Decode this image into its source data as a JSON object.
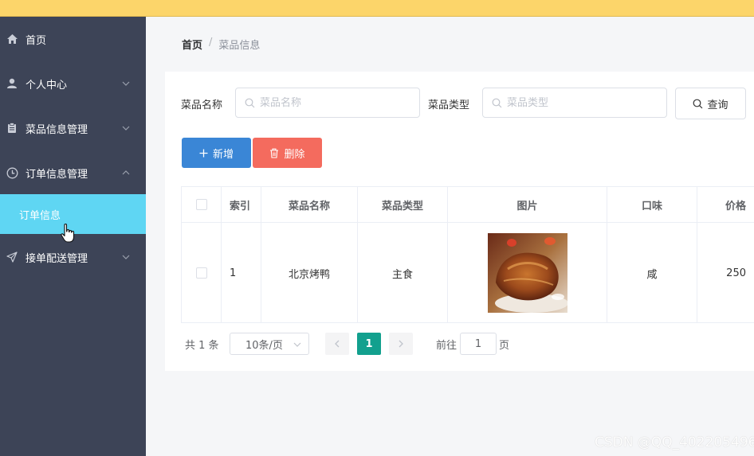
{
  "sidebar": {
    "items": [
      {
        "label": "首页",
        "icon": "home-icon"
      },
      {
        "label": "个人中心",
        "icon": "user-icon"
      },
      {
        "label": "菜品信息管理",
        "icon": "clipboard-icon"
      },
      {
        "label": "订单信息管理",
        "icon": "clock-icon"
      },
      {
        "label": "接单配送管理",
        "icon": "send-icon"
      }
    ],
    "sub_items": [
      {
        "label": "订单信息",
        "parent": "订单信息管理",
        "active": true
      }
    ]
  },
  "breadcrumb": {
    "home": "首页",
    "separator": "/",
    "current": "菜品信息"
  },
  "search": {
    "name_label": "菜品名称",
    "name_placeholder": "菜品名称",
    "type_label": "菜品类型",
    "type_placeholder": "菜品类型",
    "query_button": "查询"
  },
  "actions": {
    "add_button": "新增",
    "delete_button": "删除"
  },
  "table": {
    "columns": [
      "索引",
      "菜品名称",
      "菜品类型",
      "图片",
      "口味",
      "价格"
    ],
    "rows": [
      {
        "index": "1",
        "name": "北京烤鸭",
        "type": "主食",
        "image": "food-photo",
        "taste": "咸",
        "price": "250"
      }
    ]
  },
  "pagination": {
    "total_text": "共 1 条",
    "page_size": "10条/页",
    "current_page": "1",
    "goto_label": "前往",
    "goto_value": "1",
    "page_suffix": "页"
  },
  "watermark": "CSDN @QQ_402205496",
  "colors": {
    "topbar": "#fcd56a",
    "sidebar": "#3d4457",
    "active_submenu": "#5fd6f3",
    "primary": "#3a86d6",
    "danger": "#f46b5e",
    "pager_active": "#12a08e"
  }
}
